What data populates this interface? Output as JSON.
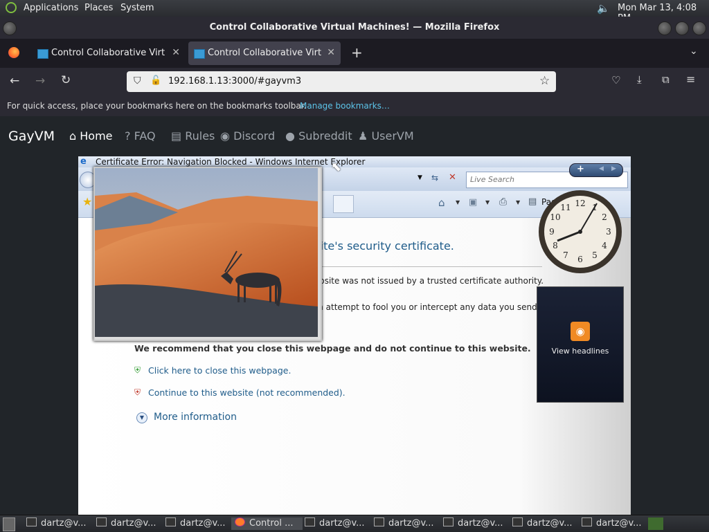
{
  "panel": {
    "menus": [
      "Applications",
      "Places",
      "System"
    ],
    "clock": "Mon Mar 13,  4:08 PM"
  },
  "window": {
    "title": "Control Collaborative Virtual Machines! — Mozilla Firefox"
  },
  "tabs": [
    {
      "label": "Control Collaborative Virtual Machines!"
    },
    {
      "label": "Control Collaborative Virtual Machines!"
    }
  ],
  "navbar": {
    "url": "192.168.1.13:3000/#gayvm3"
  },
  "bookmarks": {
    "hint": "For quick access, place your bookmarks here on the bookmarks toolbar.",
    "link": "Manage bookmarks…"
  },
  "site": {
    "brand": "GayVM",
    "nav": [
      "Home",
      "FAQ",
      "Rules",
      "Discord",
      "Subreddit",
      "UserVM"
    ]
  },
  "ie": {
    "title": "Certificate Error: Navigation Blocked - Windows Internet Explorer",
    "search_placeholder": "Live Search",
    "heading": "There is a problem with this website's security certificate.",
    "p1": "The security certificate presented by this website was not issued by a trusted certificate authority.",
    "p2": "Security certificate problems may indicate an attempt to fool you or intercept any data you send to the server.",
    "recommend": "We recommend that you close this webpage and do not continue to this website.",
    "close_link": "Click here to close this webpage.",
    "continue_link": "Continue to this website (not recommended).",
    "more_info": "More information",
    "page_menu": "Page"
  },
  "gadgets": {
    "feed_label": "View headlines"
  },
  "taskbar": {
    "items": [
      "dartz@v...",
      "dartz@v...",
      "dartz@v...",
      "Control ...",
      "dartz@v...",
      "dartz@v...",
      "dartz@v...",
      "dartz@v...",
      "dartz@v..."
    ]
  }
}
